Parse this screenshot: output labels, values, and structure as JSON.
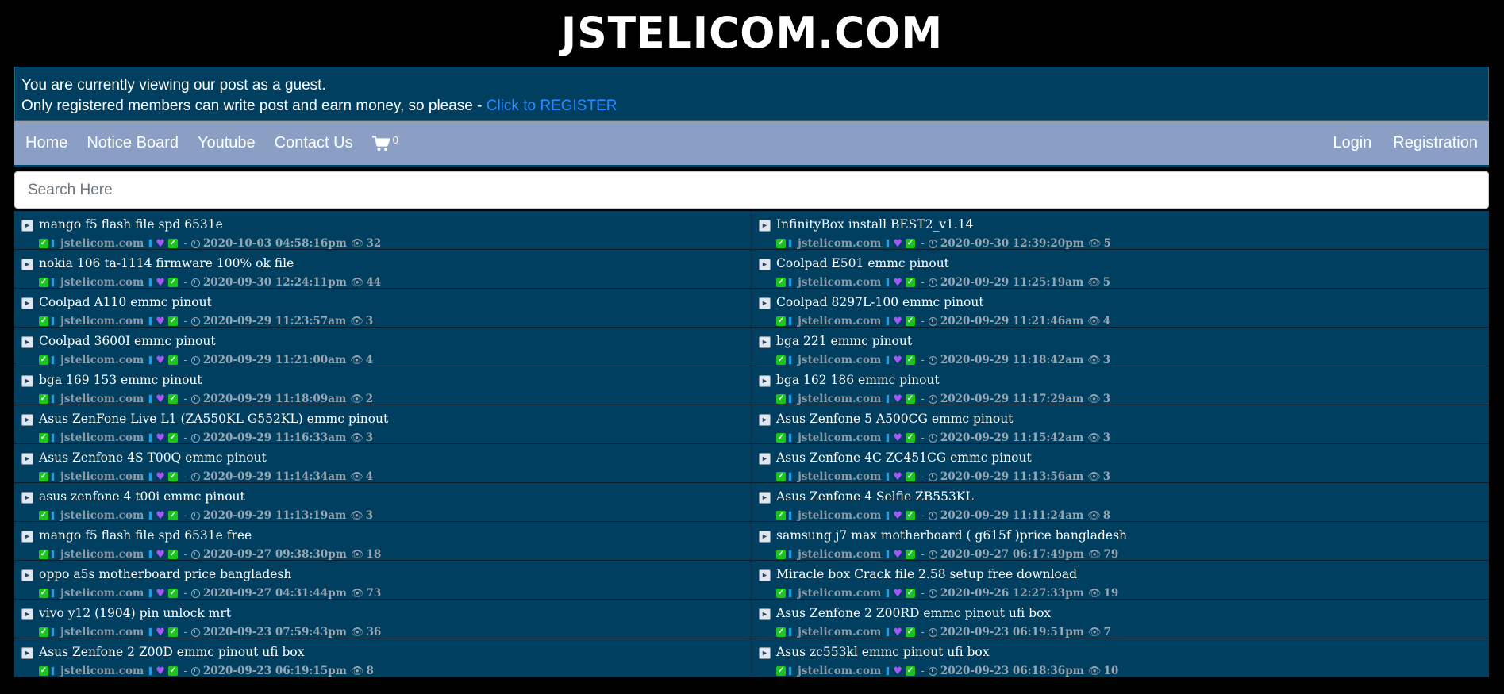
{
  "site": {
    "logo": "JSTELICOM.COM"
  },
  "notice": {
    "line1": "You are currently viewing our post as a guest.",
    "line2": "Only registered members can write post and earn money, so please - ",
    "register_link": "Click to REGISTER"
  },
  "nav": {
    "home": "Home",
    "notice_board": "Notice Board",
    "youtube": "Youtube",
    "contact": "Contact Us",
    "cart_count": "0",
    "login": "Login",
    "registration": "Registration"
  },
  "search": {
    "placeholder": "Search Here"
  },
  "colors": {
    "notice_bg": "#003f5f",
    "nav_bg": "#8a9fc3",
    "link": "#2a8cff",
    "check": "#19c61a",
    "heart": "#a855f7"
  },
  "posts": [
    {
      "title": "mango f5 flash file spd 6531e",
      "author": "jstelicom.com",
      "date": "2020-10-03 04:58:16pm",
      "views": "32"
    },
    {
      "title": "InfinityBox install BEST2_v1.14",
      "author": "jstelicom.com",
      "date": "2020-09-30 12:39:20pm",
      "views": "5"
    },
    {
      "title": "nokia 106 ta-1114 firmware 100% ok file",
      "author": "jstelicom.com",
      "date": "2020-09-30 12:24:11pm",
      "views": "44"
    },
    {
      "title": "Coolpad E501 emmc pinout",
      "author": "jstelicom.com",
      "date": "2020-09-29 11:25:19am",
      "views": "5"
    },
    {
      "title": "Coolpad A110 emmc pinout",
      "author": "jstelicom.com",
      "date": "2020-09-29 11:23:57am",
      "views": "3"
    },
    {
      "title": "Coolpad 8297L-100 emmc pinout",
      "author": "jstelicom.com",
      "date": "2020-09-29 11:21:46am",
      "views": "4"
    },
    {
      "title": "Coolpad 3600I emmc pinout",
      "author": "jstelicom.com",
      "date": "2020-09-29 11:21:00am",
      "views": "4"
    },
    {
      "title": "bga 221 emmc pinout",
      "author": "jstelicom.com",
      "date": "2020-09-29 11:18:42am",
      "views": "3"
    },
    {
      "title": "bga 169 153 emmc pinout",
      "author": "jstelicom.com",
      "date": "2020-09-29 11:18:09am",
      "views": "2"
    },
    {
      "title": "bga 162 186 emmc pinout",
      "author": "jstelicom.com",
      "date": "2020-09-29 11:17:29am",
      "views": "3"
    },
    {
      "title": "Asus ZenFone Live L1 (ZA550KL G552KL) emmc pinout",
      "author": "jstelicom.com",
      "date": "2020-09-29 11:16:33am",
      "views": "3"
    },
    {
      "title": "Asus Zenfone 5 A500CG emmc pinout",
      "author": "jstelicom.com",
      "date": "2020-09-29 11:15:42am",
      "views": "3"
    },
    {
      "title": "Asus Zenfone 4S T00Q emmc pinout",
      "author": "jstelicom.com",
      "date": "2020-09-29 11:14:34am",
      "views": "4"
    },
    {
      "title": "Asus Zenfone 4C ZC451CG emmc pinout",
      "author": "jstelicom.com",
      "date": "2020-09-29 11:13:56am",
      "views": "3"
    },
    {
      "title": "asus zenfone 4 t00i emmc pinout",
      "author": "jstelicom.com",
      "date": "2020-09-29 11:13:19am",
      "views": "3"
    },
    {
      "title": "Asus Zenfone 4 Selfie ZB553KL",
      "author": "jstelicom.com",
      "date": "2020-09-29 11:11:24am",
      "views": "8"
    },
    {
      "title": "mango f5 flash file spd 6531e free",
      "author": "jstelicom.com",
      "date": "2020-09-27 09:38:30pm",
      "views": "18"
    },
    {
      "title": "samsung j7 max motherboard ( g615f )price bangladesh",
      "author": "jstelicom.com",
      "date": "2020-09-27 06:17:49pm",
      "views": "79"
    },
    {
      "title": "oppo a5s motherboard price bangladesh",
      "author": "jstelicom.com",
      "date": "2020-09-27 04:31:44pm",
      "views": "73"
    },
    {
      "title": "Miracle box Crack file 2.58 setup free download",
      "author": "jstelicom.com",
      "date": "2020-09-26 12:27:33pm",
      "views": "19"
    },
    {
      "title": "vivo y12 (1904) pin unlock mrt",
      "author": "jstelicom.com",
      "date": "2020-09-23 07:59:43pm",
      "views": "36"
    },
    {
      "title": "Asus Zenfone 2 Z00RD emmc pinout ufi box",
      "author": "jstelicom.com",
      "date": "2020-09-23 06:19:51pm",
      "views": "7"
    },
    {
      "title": "Asus Zenfone 2 Z00D emmc pinout ufi box",
      "author": "jstelicom.com",
      "date": "2020-09-23 06:19:15pm",
      "views": "8"
    },
    {
      "title": "Asus zc553kl emmc pinout ufi box",
      "author": "jstelicom.com",
      "date": "2020-09-23 06:18:36pm",
      "views": "10"
    }
  ]
}
